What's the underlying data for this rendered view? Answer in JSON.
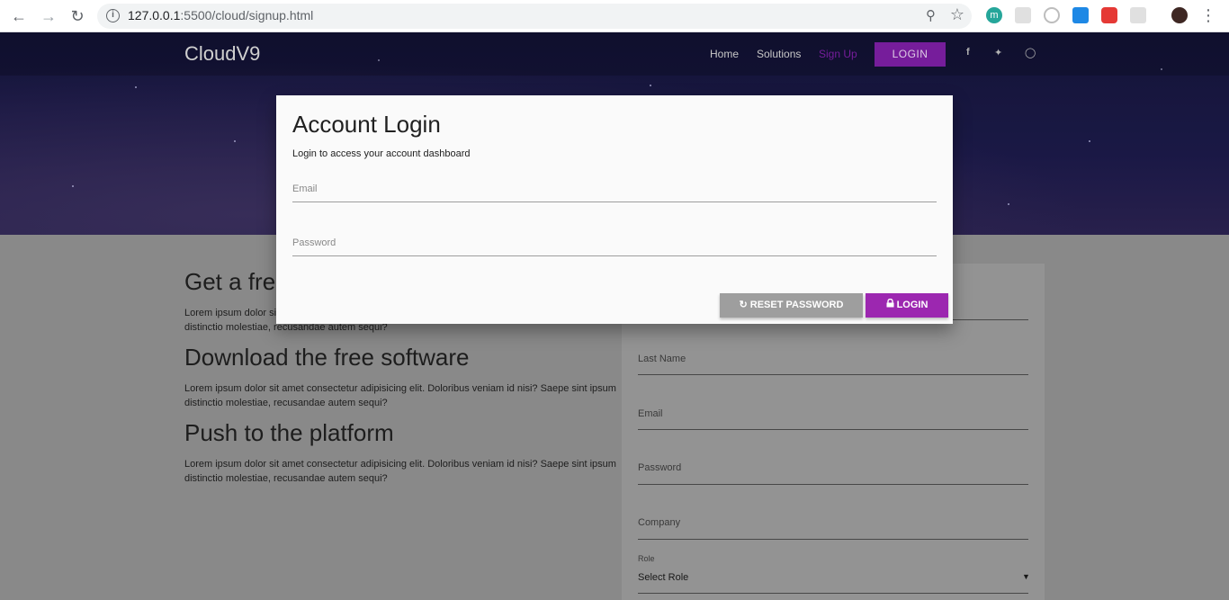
{
  "browser": {
    "url_host": "127.0.0.1",
    "url_rest": ":5500/cloud/signup.html",
    "ext_m_label": "m"
  },
  "site": {
    "brand": "CloudV9",
    "nav": {
      "home": "Home",
      "solutions": "Solutions",
      "signup": "Sign Up",
      "login": "LOGIN"
    },
    "accent_color": "#9c27b0"
  },
  "sections": [
    {
      "title": "Get a free",
      "text": "Lorem ipsum dolor sit amet consectetur adipisicing elit. Doloribus veniam id nisi? Saepe sint ipsum distinctio molestiae, recusandae autem sequi?"
    },
    {
      "title": "Download the free software",
      "text": "Lorem ipsum dolor sit amet consectetur adipisicing elit. Doloribus veniam id nisi? Saepe sint ipsum distinctio molestiae, recusandae autem sequi?"
    },
    {
      "title": "Push to the platform",
      "text": "Lorem ipsum dolor sit amet consectetur adipisicing elit. Doloribus veniam id nisi? Saepe sint ipsum distinctio molestiae, recusandae autem sequi?"
    }
  ],
  "signup_form": {
    "last_name": "Last Name",
    "email": "Email",
    "password": "Password",
    "company": "Company",
    "role_label": "Role",
    "role_value": "Select Role"
  },
  "modal": {
    "title": "Account Login",
    "subtitle": "Login to access your account dashboard",
    "email_placeholder": "Email",
    "password_placeholder": "Password",
    "reset_label": "RESET PASSWORD",
    "login_label": "LOGIN"
  }
}
